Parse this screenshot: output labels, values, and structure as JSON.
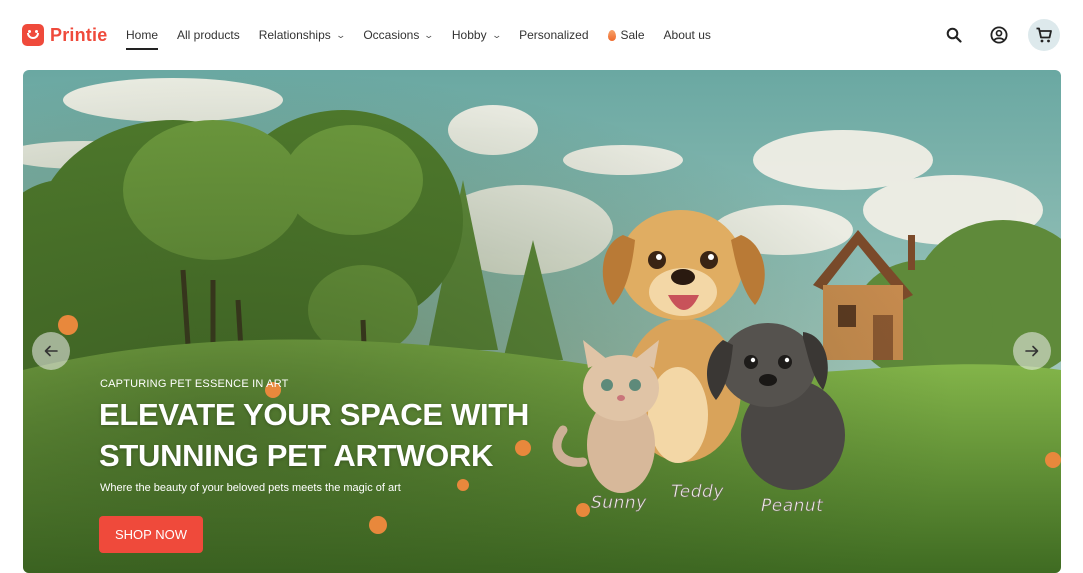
{
  "brand": {
    "name": "Printie",
    "accent": "#ef4a3b"
  },
  "nav": {
    "items": [
      {
        "label": "Home",
        "active": true,
        "dropdown": false
      },
      {
        "label": "All products",
        "dropdown": false
      },
      {
        "label": "Relationships",
        "dropdown": true
      },
      {
        "label": "Occasions",
        "dropdown": true
      },
      {
        "label": "Hobby",
        "dropdown": true
      },
      {
        "label": "Personalized",
        "dropdown": false
      },
      {
        "label": "Sale",
        "dropdown": false,
        "icon": "flame-icon"
      },
      {
        "label": "About us",
        "dropdown": false
      }
    ]
  },
  "header_icons": [
    "search-icon",
    "account-icon",
    "cart-icon"
  ],
  "hero": {
    "eyebrow": "CAPTURING PET ESSENCE IN ART",
    "headline": "ELEVATE YOUR SPACE WITH STUNNING PET ARTWORK",
    "subline": "Where the beauty of your beloved pets meets the magic of art",
    "cta": "SHOP NOW",
    "pet_names": [
      "Sunny",
      "Teddy",
      "Peanut"
    ],
    "controls": [
      "arrow-left-icon",
      "arrow-right-icon"
    ]
  }
}
